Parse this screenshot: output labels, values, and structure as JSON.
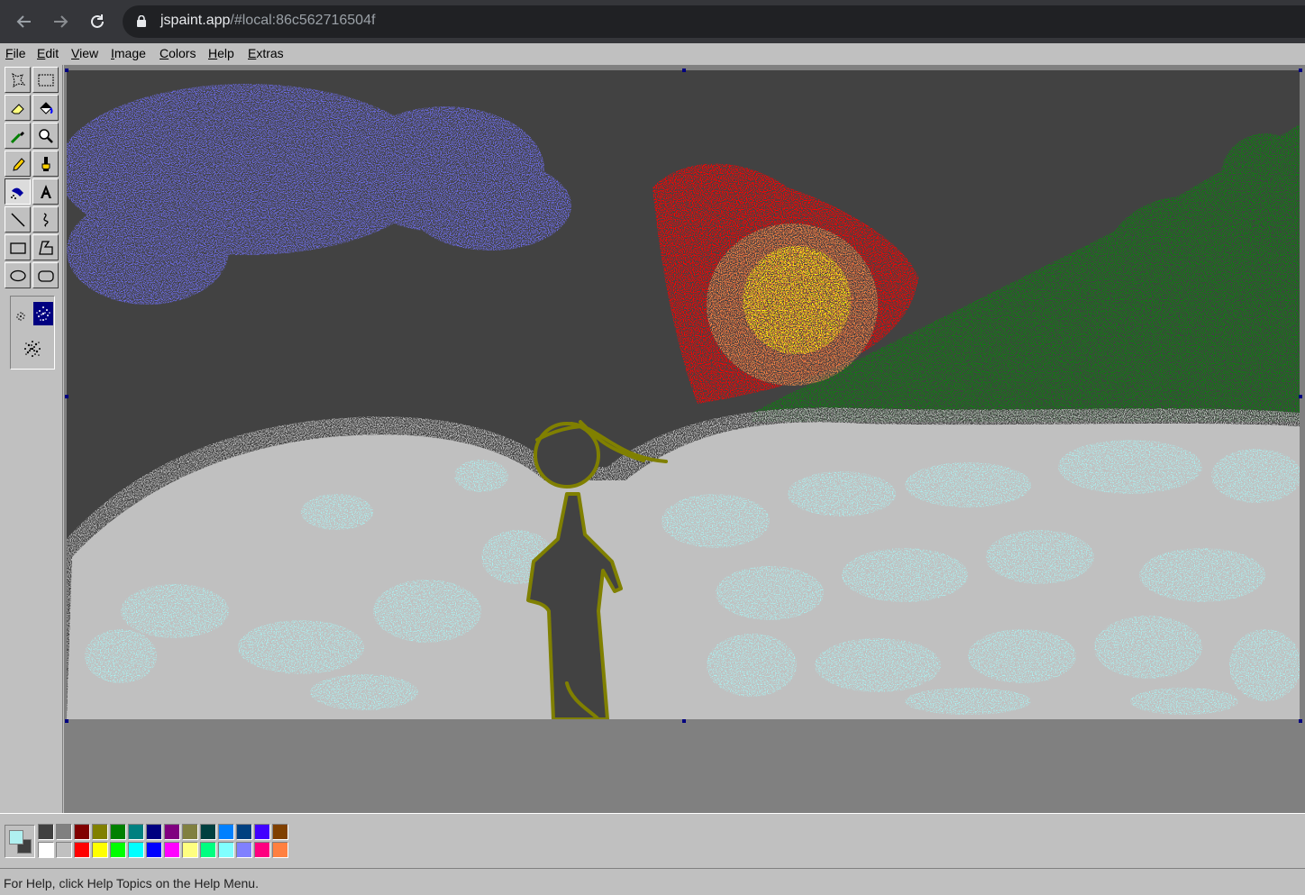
{
  "browser": {
    "back_icon": "arrow-left-icon",
    "forward_icon": "arrow-right-icon",
    "reload_icon": "reload-icon",
    "lock_icon": "lock-icon",
    "url_host": "jspaint.app",
    "url_path": "/#local:86c562716504f"
  },
  "menu": {
    "file": "File",
    "edit": "Edit",
    "view": "View",
    "image": "Image",
    "colors": "Colors",
    "help": "Help",
    "extras": "Extras"
  },
  "toolbox": {
    "tools": [
      {
        "name": "free-form-select",
        "icon": "free-form-select-icon"
      },
      {
        "name": "select",
        "icon": "rectangle-select-icon"
      },
      {
        "name": "eraser",
        "icon": "eraser-icon"
      },
      {
        "name": "fill",
        "icon": "paint-bucket-icon"
      },
      {
        "name": "pick-color",
        "icon": "eyedropper-icon"
      },
      {
        "name": "magnifier",
        "icon": "magnifier-icon"
      },
      {
        "name": "pencil",
        "icon": "pencil-icon"
      },
      {
        "name": "brush",
        "icon": "brush-icon"
      },
      {
        "name": "airbrush",
        "icon": "airbrush-icon",
        "selected": true
      },
      {
        "name": "text",
        "icon": "text-icon"
      },
      {
        "name": "line",
        "icon": "line-icon"
      },
      {
        "name": "curve",
        "icon": "curve-icon"
      },
      {
        "name": "rectangle",
        "icon": "rectangle-icon"
      },
      {
        "name": "polygon",
        "icon": "polygon-icon"
      },
      {
        "name": "ellipse",
        "icon": "ellipse-icon"
      },
      {
        "name": "rounded-rectangle",
        "icon": "rounded-rectangle-icon"
      }
    ],
    "airbrush_sizes": [
      "small",
      "medium",
      "large"
    ],
    "selected_airbrush_size": "medium"
  },
  "colors": {
    "primary": "#b0f0f0",
    "secondary": "#404040",
    "palette_top": [
      "#404040",
      "#808080",
      "#800000",
      "#808000",
      "#008000",
      "#008080",
      "#000080",
      "#800080",
      "#808040",
      "#004040",
      "#0080ff",
      "#004080",
      "#4000ff",
      "#804000"
    ],
    "palette_bottom": [
      "#ffffff",
      "#c0c0c0",
      "#ff0000",
      "#ffff00",
      "#00ff00",
      "#00ffff",
      "#0000ff",
      "#ff00ff",
      "#ffff80",
      "#00ff80",
      "#80ffff",
      "#8080ff",
      "#ff0080",
      "#ff8040"
    ]
  },
  "canvas": {
    "background": "#424242",
    "snow": "#c0c0c0",
    "snowflakes": "#aaf0f0",
    "cloud": "#6a6ae0",
    "fire_outer": "#ff0000",
    "fire_mid": "#e8884a",
    "fire_core": "#ffff00",
    "forest": "#0a8010",
    "figure_outline": "#808000"
  },
  "status": {
    "text": "For Help, click Help Topics on the Help Menu."
  }
}
